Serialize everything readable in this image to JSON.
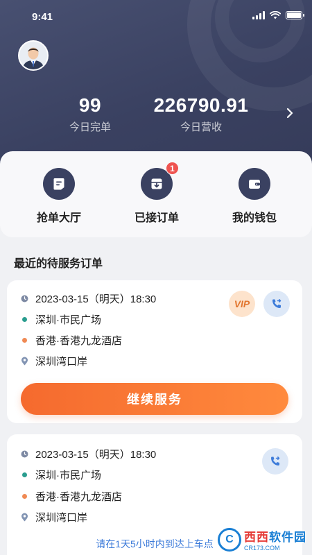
{
  "status": {
    "time": "9:41"
  },
  "header": {
    "stats": [
      {
        "value": "99",
        "label": "今日完单"
      },
      {
        "value": "226790.91",
        "label": "今日营收"
      }
    ]
  },
  "quick_actions": [
    {
      "label": "抢单大厅",
      "icon": "document-icon"
    },
    {
      "label": "已接订单",
      "icon": "inbox-icon",
      "badge": "1"
    },
    {
      "label": "我的钱包",
      "icon": "wallet-icon"
    }
  ],
  "section": {
    "title": "最近的待服务订单"
  },
  "orders": [
    {
      "datetime": "2023-03-15（明天）18:30",
      "from": "深圳·市民广场",
      "to": "香港·香港九龙酒店",
      "via": "深圳湾口岸",
      "vip": "VIP",
      "action_label": "继续服务"
    },
    {
      "datetime": "2023-03-15（明天）18:30",
      "from": "深圳·市民广场",
      "to": "香港·香港九龙酒店",
      "via": "深圳湾口岸",
      "hint": "请在1天5小时内到达上车点"
    }
  ],
  "watermark": {
    "main_red": "C",
    "main": "西西",
    "brand": "软件园",
    "sub": "CR173.COM"
  },
  "colors": {
    "header": "#3a4161",
    "accent": "#f56a2e",
    "badge": "#ef5350",
    "link": "#3d7bd9"
  }
}
